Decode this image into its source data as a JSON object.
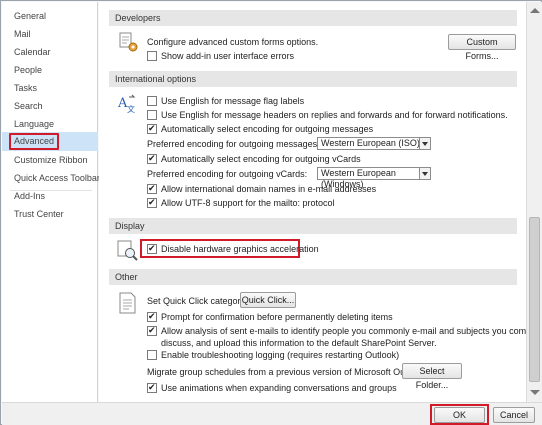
{
  "sidebar": {
    "items": [
      {
        "label": "General"
      },
      {
        "label": "Mail"
      },
      {
        "label": "Calendar"
      },
      {
        "label": "People"
      },
      {
        "label": "Tasks"
      },
      {
        "label": "Search"
      },
      {
        "label": "Language"
      },
      {
        "label": "Advanced"
      },
      {
        "label": "Customize Ribbon"
      },
      {
        "label": "Quick Access Toolbar"
      },
      {
        "label": "Add-Ins"
      },
      {
        "label": "Trust Center"
      }
    ]
  },
  "developers": {
    "header": "Developers",
    "custom_forms_text": "Configure advanced custom forms options.",
    "custom_forms_button": "Custom Forms...",
    "addin_errors": {
      "label": "Show add-in user interface errors",
      "checked": false
    }
  },
  "international": {
    "header": "International options",
    "english_flag": {
      "label": "Use English for message flag labels",
      "checked": false
    },
    "english_headers": {
      "label": "Use English for message headers on replies and forwards and for forward notifications.",
      "checked": false
    },
    "auto_encoding_outgoing": {
      "label": "Automatically select encoding for outgoing messages",
      "checked": true
    },
    "preferred_outgoing_label": "Preferred encoding for outgoing messages:",
    "preferred_outgoing_value": "Western European (ISO)",
    "auto_encoding_vcards": {
      "label": "Automatically select encoding for outgoing vCards",
      "checked": true
    },
    "preferred_vcards_label": "Preferred encoding for outgoing vCards:",
    "preferred_vcards_value": "Western European (Windows)",
    "intl_domain": {
      "label": "Allow international domain names in e-mail addresses",
      "checked": true
    },
    "utf8_mailto": {
      "label": "Allow UTF-8 support for the mailto: protocol",
      "checked": true
    }
  },
  "display": {
    "header": "Display",
    "disable_hw_accel": {
      "label": "Disable hardware graphics acceleration",
      "checked": true
    }
  },
  "other": {
    "header": "Other",
    "quick_click_label": "Set Quick Click category:",
    "quick_click_button": "Quick Click...",
    "prompt_delete": {
      "label": "Prompt for confirmation before permanently deleting items",
      "checked": true
    },
    "analysis_line1": "Allow analysis of sent e-mails to identify people you commonly e-mail and subjects you commonly",
    "analysis_line2": "discuss, and upload this information to the default SharePoint Server.",
    "analysis_checked": true,
    "troubleshooting": {
      "label": "Enable troubleshooting logging (requires restarting Outlook)",
      "checked": false
    },
    "migrate_label": "Migrate group schedules from a previous version of Microsoft Outlook:",
    "select_folder_button": "Select Folder...",
    "animations": {
      "label": "Use animations when expanding conversations and groups",
      "checked": true
    }
  },
  "footer": {
    "ok_label": "OK",
    "cancel_label": "Cancel"
  },
  "colors": {
    "accent_selection": "#cde3f7",
    "highlight_red": "#d11a2a",
    "section_bg": "#e6e6e6"
  }
}
